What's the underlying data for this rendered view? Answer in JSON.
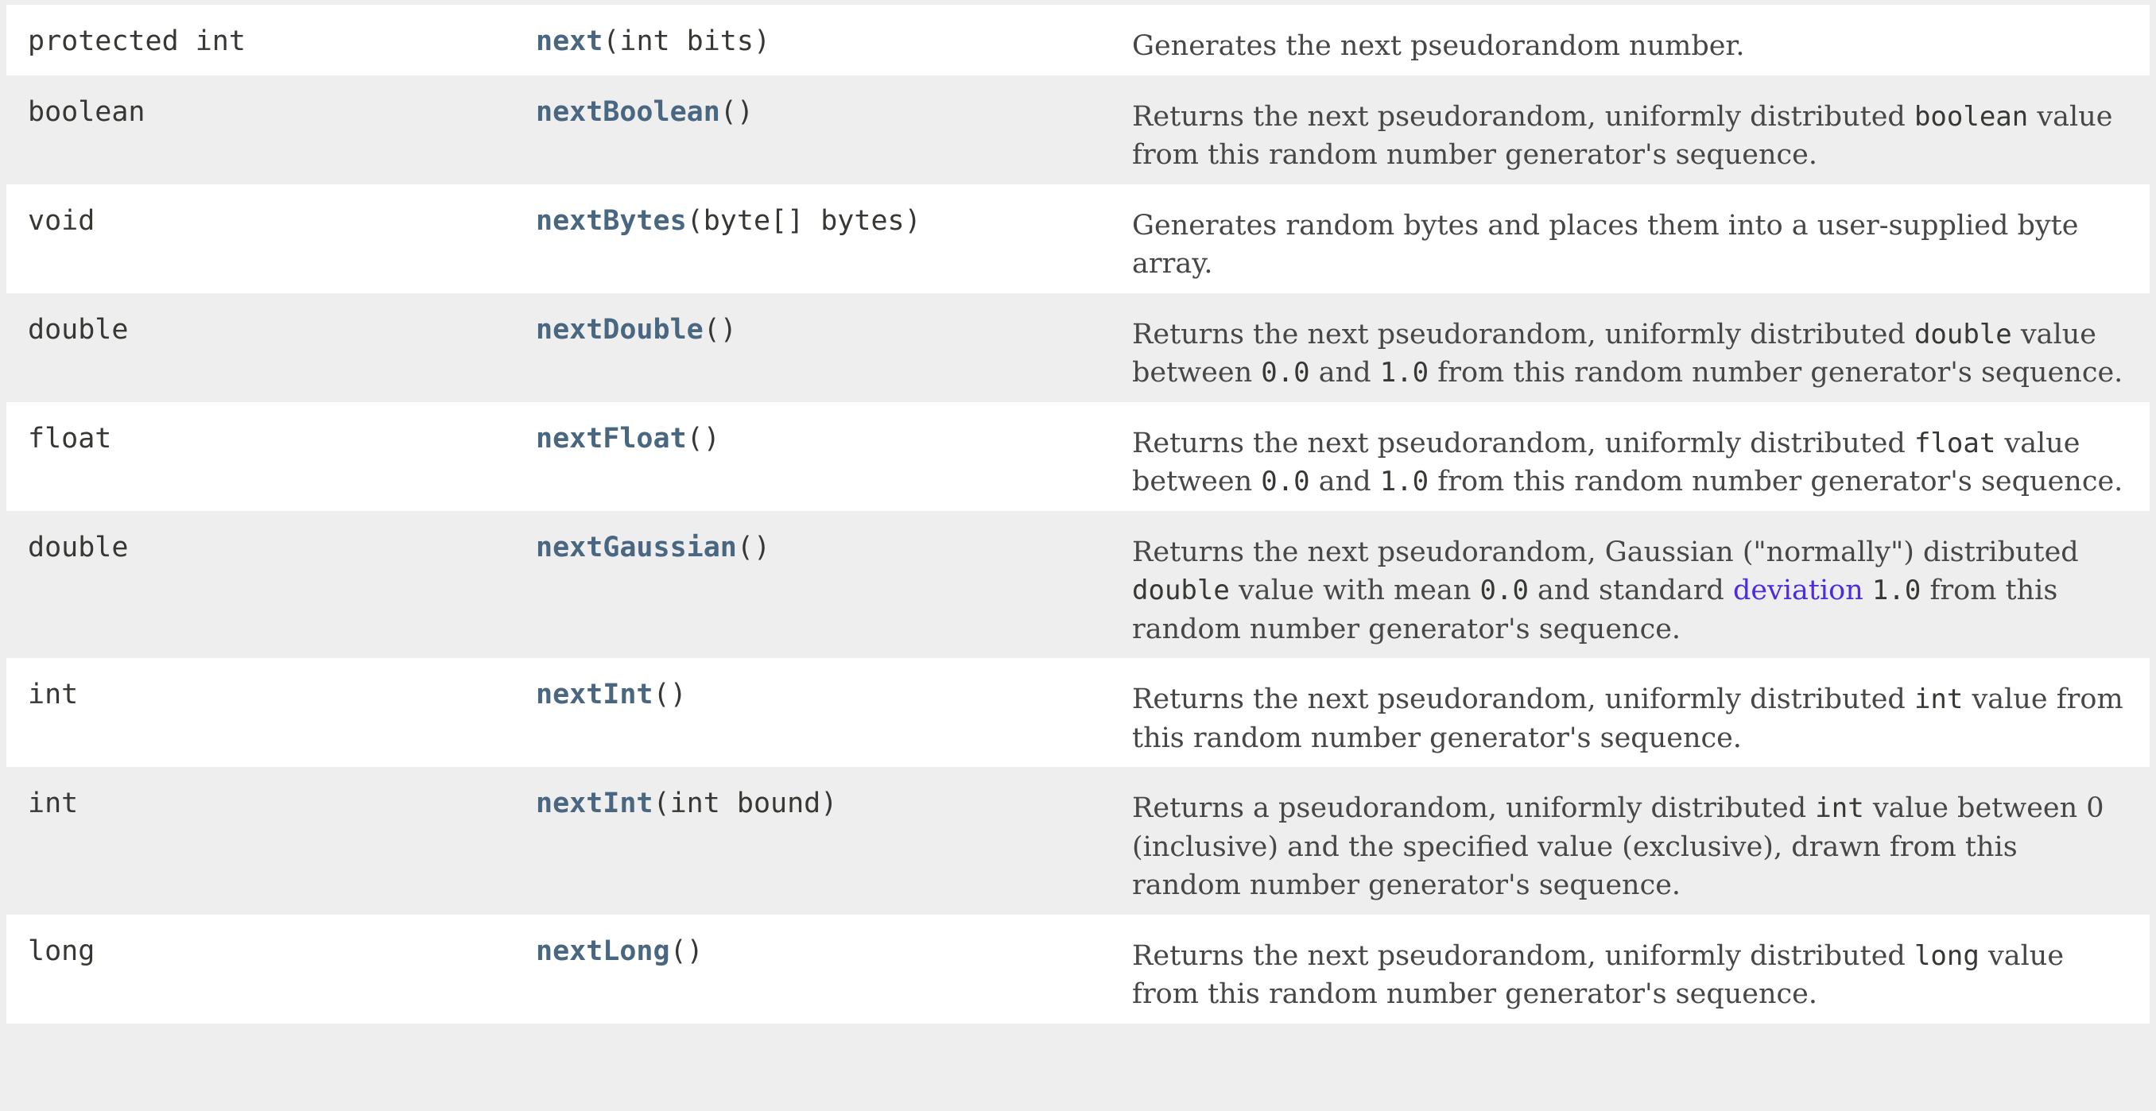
{
  "methods": [
    {
      "modifier": "protected int",
      "name": "next",
      "params": "(int bits)",
      "desc": [
        {
          "t": "Generates the next pseudorandom number."
        }
      ]
    },
    {
      "modifier": "boolean",
      "name": "nextBoolean",
      "params": "()",
      "desc": [
        {
          "t": "Returns the next pseudorandom, uniformly distributed "
        },
        {
          "c": "boolean"
        },
        {
          "t": " value from this random number generator's sequence."
        }
      ]
    },
    {
      "modifier": "void",
      "name": "nextBytes",
      "params": "(byte[] bytes)",
      "desc": [
        {
          "t": "Generates random bytes and places them into a user-supplied byte array."
        }
      ]
    },
    {
      "modifier": "double",
      "name": "nextDouble",
      "params": "()",
      "desc": [
        {
          "t": "Returns the next pseudorandom, uniformly distributed "
        },
        {
          "c": "double"
        },
        {
          "t": " value between "
        },
        {
          "c": "0.0"
        },
        {
          "t": " and "
        },
        {
          "c": "1.0"
        },
        {
          "t": " from this random number generator's sequence."
        }
      ]
    },
    {
      "modifier": "float",
      "name": "nextFloat",
      "params": "()",
      "desc": [
        {
          "t": "Returns the next pseudorandom, uniformly distributed "
        },
        {
          "c": "float"
        },
        {
          "t": " value between "
        },
        {
          "c": "0.0"
        },
        {
          "t": " and "
        },
        {
          "c": "1.0"
        },
        {
          "t": " from this random number generator's sequence."
        }
      ]
    },
    {
      "modifier": "double",
      "name": "nextGaussian",
      "params": "()",
      "desc": [
        {
          "t": "Returns the next pseudorandom, Gaussian (\"normally\") distributed "
        },
        {
          "c": "double"
        },
        {
          "t": " value with mean "
        },
        {
          "c": "0.0"
        },
        {
          "t": " and standard "
        },
        {
          "l": "deviation"
        },
        {
          "t": " "
        },
        {
          "c": "1.0"
        },
        {
          "t": " from this random number generator's sequence."
        }
      ]
    },
    {
      "modifier": "int",
      "name": "nextInt",
      "params": "()",
      "desc": [
        {
          "t": "Returns the next pseudorandom, uniformly distributed "
        },
        {
          "c": "int"
        },
        {
          "t": " value from this random number generator's sequence."
        }
      ]
    },
    {
      "modifier": "int",
      "name": "nextInt",
      "params": "(int bound)",
      "desc": [
        {
          "t": "Returns a pseudorandom, uniformly distributed "
        },
        {
          "c": "int"
        },
        {
          "t": " value between 0 (inclusive) and the specified value (exclusive), drawn from this random number generator's sequence."
        }
      ]
    },
    {
      "modifier": "long",
      "name": "nextLong",
      "params": "()",
      "desc": [
        {
          "t": "Returns the next pseudorandom, uniformly distributed "
        },
        {
          "c": "long"
        },
        {
          "t": " value from this random number generator's sequence."
        }
      ]
    }
  ]
}
